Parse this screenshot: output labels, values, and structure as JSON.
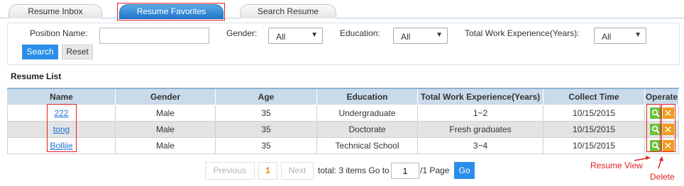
{
  "tabs": [
    {
      "label": "Resume Inbox",
      "active": false
    },
    {
      "label": "Resume Favorites",
      "active": true
    },
    {
      "label": "Search Resume",
      "active": false
    }
  ],
  "filter": {
    "position_label": "Position Name:",
    "position_value": "",
    "gender_label": "Gender:",
    "gender_value": "All",
    "education_label": "Education:",
    "education_value": "All",
    "experience_label": "Total Work Experience(Years):",
    "experience_value": "All",
    "search_label": "Search",
    "reset_label": "Reset"
  },
  "section_title": "Resume List",
  "table": {
    "headers": [
      "Name",
      "Gender",
      "Age",
      "Education",
      "Total Work Experience(Years)",
      "Collect Time",
      "Operate"
    ],
    "rows": [
      {
        "name": "222",
        "gender": "Male",
        "age": "35",
        "education": "Undergraduate",
        "experience": "1~2",
        "collect_time": "10/15/2015"
      },
      {
        "name": "tong",
        "gender": "Male",
        "age": "35",
        "education": "Doctorate",
        "experience": "Fresh graduates",
        "collect_time": "10/15/2015"
      },
      {
        "name": "Bolljie",
        "gender": "Male",
        "age": "35",
        "education": "Technical School",
        "experience": "3~4",
        "collect_time": "10/15/2015"
      }
    ]
  },
  "pagination": {
    "prev_label": "Previous",
    "current_page": "1",
    "next_label": "Next",
    "total_text": "total: 3 items Go to",
    "go_value": "1",
    "page_suffix": "/1 Page",
    "go_label": "Go"
  },
  "annotations": {
    "view": "Resume View",
    "delete": "Delete"
  },
  "colors": {
    "accent_blue": "#2b8ee8",
    "header_bg": "#c9dbea",
    "annotation_red": "#e02020",
    "view_icon_green": "#6cc23a",
    "delete_icon_orange": "#f19a1d"
  }
}
